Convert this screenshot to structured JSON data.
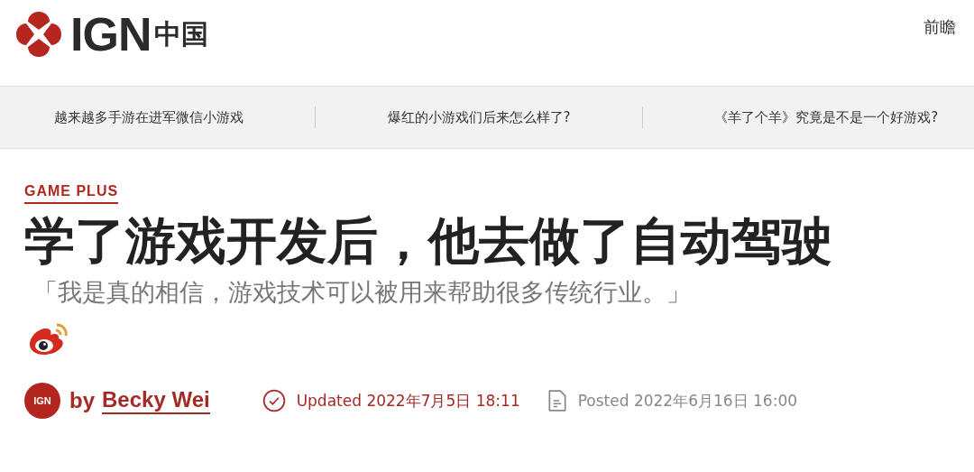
{
  "header": {
    "logo_text": "IGN",
    "logo_region": "中国",
    "menu_link": "前瞻"
  },
  "nav_links": [
    "越来越多手游在进军微信小游戏",
    "爆红的小游戏们后来怎么样了?",
    "《羊了个羊》究竟是不是一个好游戏?"
  ],
  "article": {
    "category": "GAME PLUS",
    "title": "学了游戏开发后，他去做了自动驾驶",
    "subtitle": "「我是真的相信，游戏技术可以被用来帮助很多传统行业。」",
    "byline": {
      "avatar_text": "IGN",
      "by": "by",
      "author": "Becky Wei",
      "updated": "Updated 2022年7月5日 18:11",
      "posted": "Posted 2022年6月16日 16:00"
    }
  }
}
